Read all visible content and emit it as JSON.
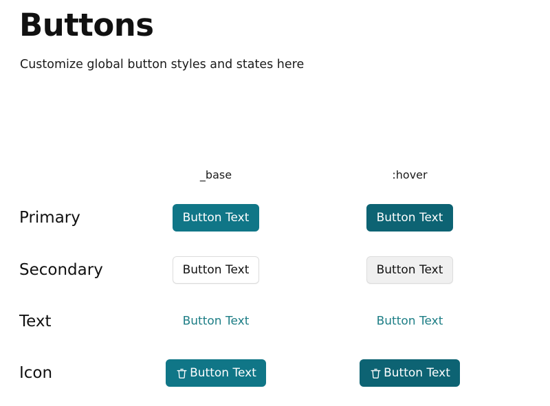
{
  "header": {
    "title": "Buttons",
    "subtitle": "Customize global button styles and states here"
  },
  "matrix": {
    "columns": [
      {
        "label": "_base",
        "key": "base"
      },
      {
        "label": ":hover",
        "key": "hover"
      }
    ],
    "rows": [
      {
        "label": "Primary",
        "variant": "primary",
        "cells": [
          {
            "state": "_base",
            "button_label": "Button Text"
          },
          {
            "state": ":hover",
            "button_label": "Button Text"
          }
        ]
      },
      {
        "label": "Secondary",
        "variant": "secondary",
        "cells": [
          {
            "state": "_base",
            "button_label": "Button Text"
          },
          {
            "state": ":hover",
            "button_label": "Button Text"
          }
        ]
      },
      {
        "label": "Text",
        "variant": "text",
        "cells": [
          {
            "state": "_base",
            "button_label": "Button Text"
          },
          {
            "state": ":hover",
            "button_label": "Button Text"
          }
        ]
      },
      {
        "label": "Icon",
        "variant": "icon",
        "icon": "trash-icon",
        "cells": [
          {
            "state": "_base",
            "button_label": "Button Text"
          },
          {
            "state": ":hover",
            "button_label": "Button Text"
          }
        ]
      }
    ]
  },
  "colors": {
    "background": "#ffffff",
    "primary": "#107687",
    "primary_hover": "#0d6373",
    "secondary_background": "#ffffff",
    "secondary_hover_background": "#f0f0f0",
    "secondary_border": "#dcdcdc",
    "text_button": "#1c7d85",
    "text_primary": "#111111"
  }
}
